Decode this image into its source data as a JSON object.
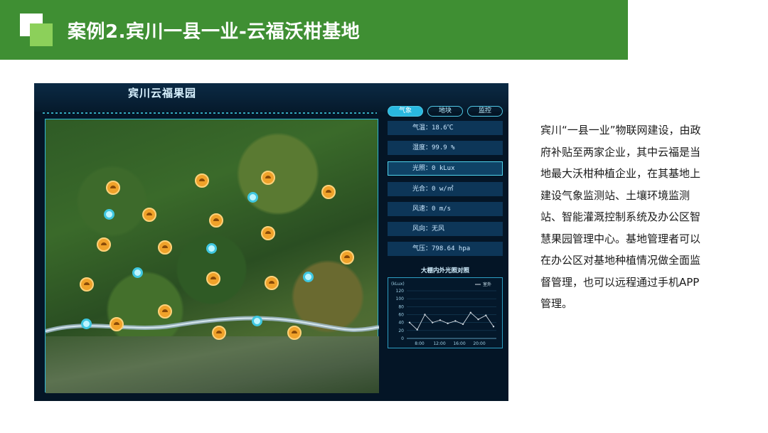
{
  "header": {
    "title": "案例2.宾川一县一业-云福沃柑基地"
  },
  "dashboard": {
    "title": "宾川云福果园",
    "tabs": [
      "气象",
      "地块",
      "监控"
    ],
    "active_tab": "气象",
    "sensors": [
      {
        "label": "气温：18.6℃"
      },
      {
        "label": "湿度：99.9 %"
      },
      {
        "label": "光照：0 kLux"
      },
      {
        "label": "光合：0 w/㎡"
      },
      {
        "label": "风速：0 m/s"
      },
      {
        "label": "风向：无风"
      },
      {
        "label": "气压：798.64 hpa"
      }
    ],
    "chart_title": "大棚内外光照对照",
    "chart_data": {
      "type": "line",
      "ylabel": "(kLux)",
      "ylim": [
        0,
        120
      ],
      "yticks": [
        "120",
        "100",
        "80",
        "60",
        "40",
        "20",
        "0"
      ],
      "xticks": [
        "8:00",
        "12:00",
        "16:00",
        "20:00"
      ],
      "series": [
        {
          "name": "室外",
          "values": [
            40,
            22,
            60,
            40,
            46,
            38,
            44,
            36,
            65,
            48,
            58,
            30
          ]
        }
      ],
      "legend": "top-right",
      "colors": {
        "line": "#cfd8e0",
        "axis": "#6fb8d8"
      }
    }
  },
  "description": "宾川“一县一业”物联网建设，由政府补贴至两家企业，其中云福是当地最大沃柑种植企业，在其基地上建设气象监测站、土壤环境监测站、智能灌溉控制系统及办公区智慧果园管理中心。基地管理者可以在办公区对基地种植情况做全面监督管理，也可以远程通过手机APP管理。",
  "colors": {
    "title_bar": "#3f8f33",
    "accent": "#29b8e0",
    "marker_weather": "#f0a22a",
    "marker_water": "#3fc7e0"
  }
}
